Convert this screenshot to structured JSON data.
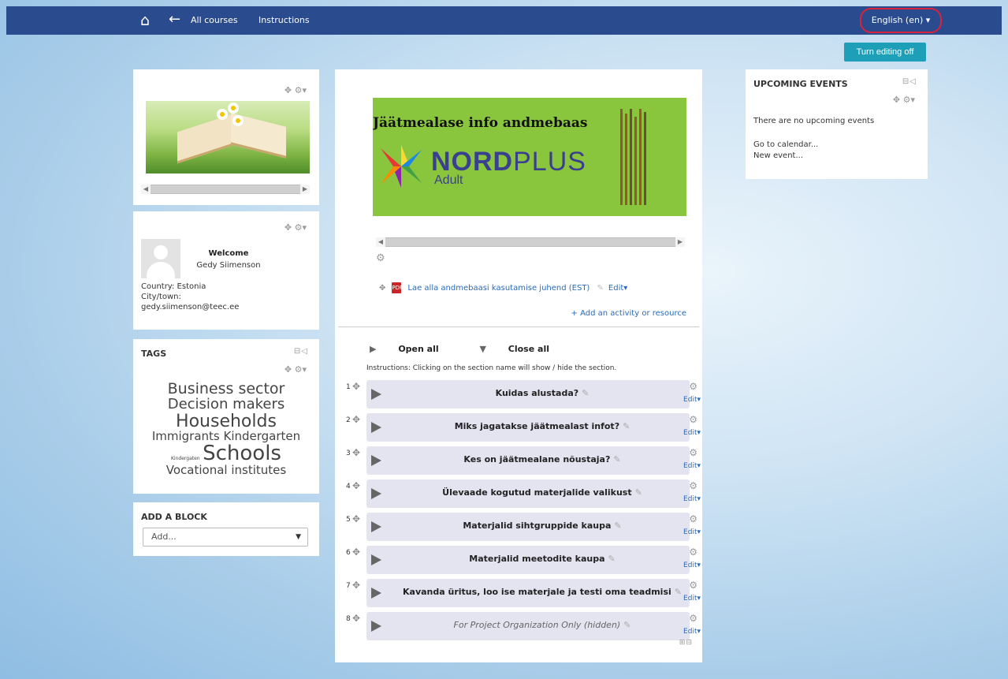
{
  "topbar": {
    "nav_all_courses": "All courses",
    "nav_instructions": "Instructions",
    "language": "English (en) ▾",
    "bg_color": "#2a4b8d"
  },
  "editing": {
    "turn_editing_label": "Turn editing off",
    "color": "#1d9fb8"
  },
  "user_block": {
    "welcome": "Welcome",
    "name": "Gedy Siimenson",
    "country": "Country: Estonia",
    "city": "City/town:",
    "email": "gedy.siimenson@teec.ee"
  },
  "tags_block": {
    "title": "TAGS",
    "tags": [
      "Business sector",
      "Decision makers",
      "Households",
      "Immigrants",
      "Kindergarten",
      "Kindergaten",
      "Schools",
      "Vocational institutes"
    ]
  },
  "add_block": {
    "title": "ADD A BLOCK",
    "select_value": "Add..."
  },
  "banner": {
    "title": "Jäätmealase info andmebaas",
    "brand_strong": "NORD",
    "brand_light": "PLUS",
    "subtitle": "Adult",
    "bg_color": "#8ac53e"
  },
  "resource": {
    "link": "Lae alla andmebaasi kasutamise juhend (EST)",
    "edit": "Edit▾"
  },
  "add_activity": "+ Add an activity or resource",
  "sections_controls": {
    "open_all": "Open all",
    "close_all": "Close all",
    "instructions": "Instructions: Clicking on the section name will show / hide the section."
  },
  "sections": [
    {
      "num": "1",
      "name": "Kuidas alustada?"
    },
    {
      "num": "2",
      "name": "Miks jagatakse jäätmealast infot?"
    },
    {
      "num": "3",
      "name": "Kes on jäätmealane nõustaja?"
    },
    {
      "num": "4",
      "name": "Ülevaade kogutud materjalide valikust"
    },
    {
      "num": "5",
      "name": "Materjalid sihtgruppide kaupa"
    },
    {
      "num": "6",
      "name": "Materjalid meetodite kaupa"
    },
    {
      "num": "7",
      "name": "Kavanda üritus, loo ise materjale ja testi oma teadmisi"
    },
    {
      "num": "8",
      "name": "For Project Organization Only (hidden)"
    }
  ],
  "section_edit_label": "Edit▾",
  "events_block": {
    "title": "UPCOMING EVENTS",
    "none": "There are no upcoming events",
    "go_calendar": "Go to calendar...",
    "new_event": "New event..."
  }
}
